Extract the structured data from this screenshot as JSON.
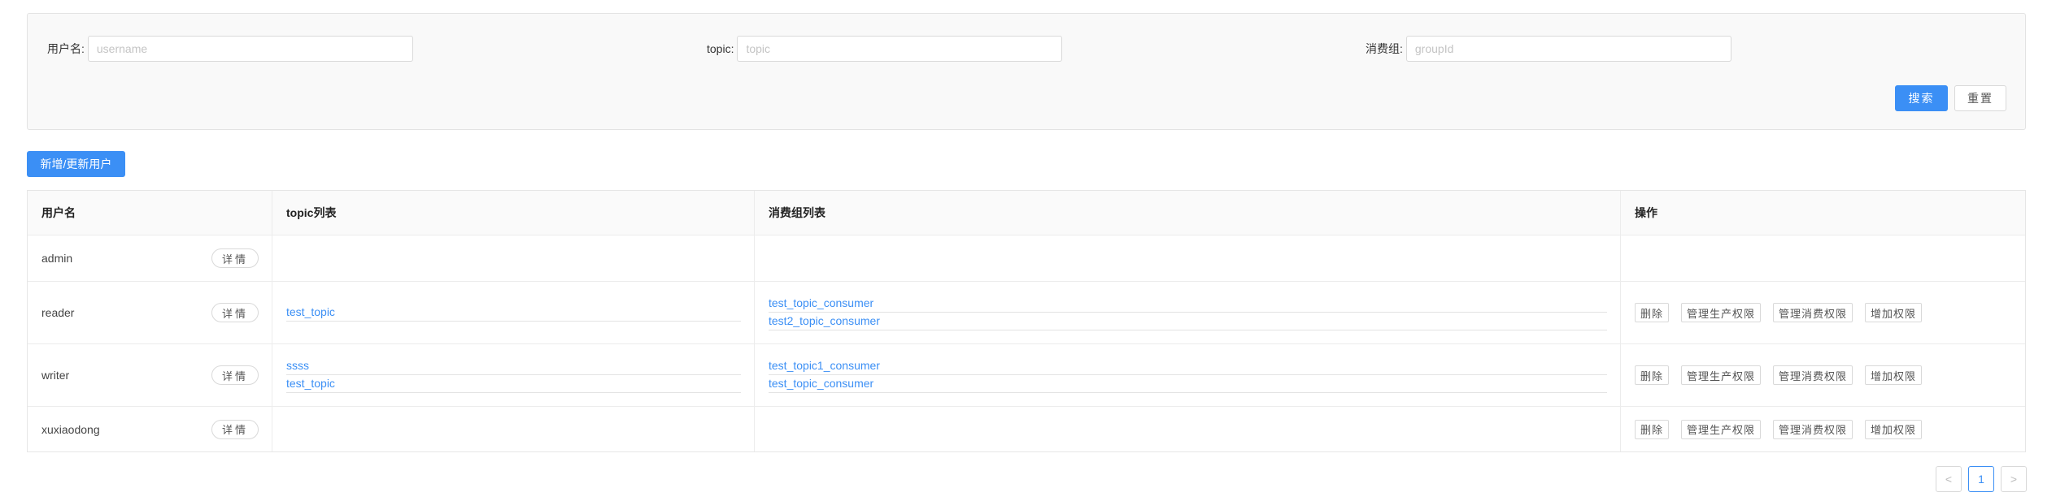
{
  "search": {
    "username_label": "用户名:",
    "username_placeholder": "username",
    "username_value": "",
    "topic_label": "topic:",
    "topic_placeholder": "topic",
    "topic_value": "",
    "group_label": "消费组:",
    "group_placeholder": "groupId",
    "group_value": "",
    "search_button": "搜索",
    "reset_button": "重置"
  },
  "toolbar": {
    "add_update_user": "新增/更新用户"
  },
  "table": {
    "headers": [
      "用户名",
      "topic列表",
      "消费组列表",
      "操作"
    ],
    "detail_label": "详情",
    "ops": {
      "delete": "删除",
      "manage_produce": "管理生产权限",
      "manage_consume": "管理消费权限",
      "add_permission": "增加权限"
    },
    "rows": [
      {
        "username": "admin",
        "topics": [],
        "groups": []
      },
      {
        "username": "reader",
        "topics": [
          "test_topic"
        ],
        "groups": [
          "test_topic_consumer",
          "test2_topic_consumer"
        ]
      },
      {
        "username": "writer",
        "topics": [
          "ssss",
          "test_topic"
        ],
        "groups": [
          "test_topic1_consumer",
          "test_topic_consumer"
        ]
      },
      {
        "username": "xuxiaodong",
        "topics": [],
        "groups": []
      }
    ]
  },
  "pagination": {
    "prev": "<",
    "current_page": "1",
    "next": ">"
  }
}
